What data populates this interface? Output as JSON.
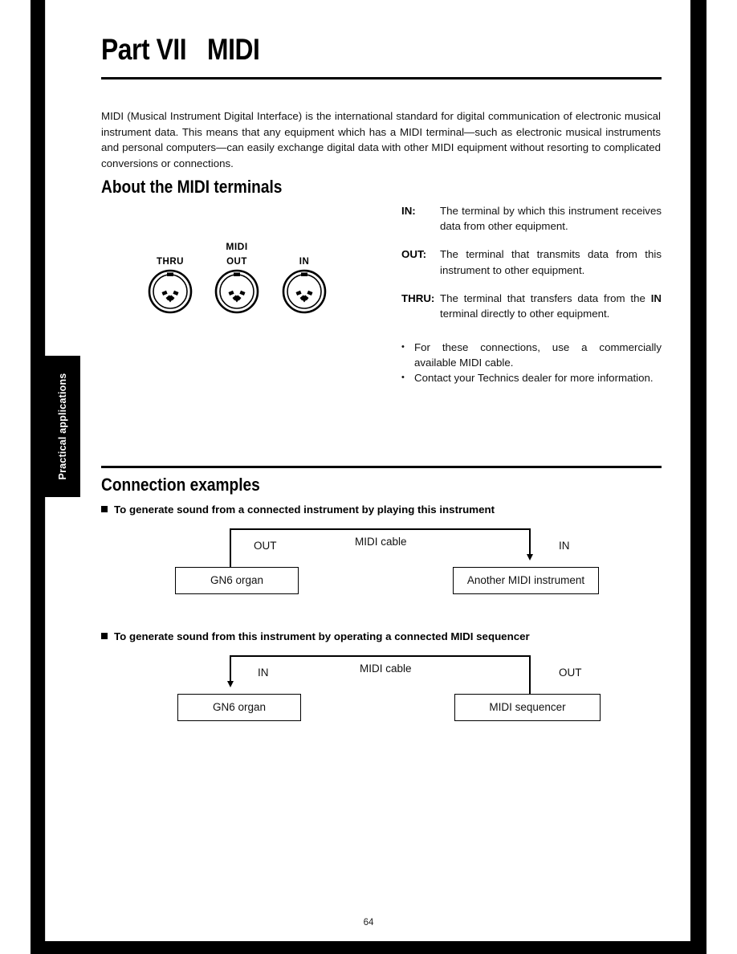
{
  "page": {
    "number": "64",
    "side_tab_label": "Practical applications"
  },
  "header": {
    "part_label": "Part VII",
    "part_title": "MIDI"
  },
  "intro": {
    "paragraph": "MIDI (Musical Instrument Digital Interface) is the international standard for digital communication of electronic musical instrument data. This means that any equipment which has a MIDI terminal—such as electronic musical instruments and personal computers—can easily exchange digital data with other MIDI equipment without resorting to complicated conversions or connections."
  },
  "terminals_section": {
    "heading": "About the MIDI terminals",
    "diagram": {
      "group_label": "MIDI",
      "jacks": [
        {
          "label": "THRU"
        },
        {
          "label": "OUT"
        },
        {
          "label": "IN"
        }
      ]
    },
    "definitions": [
      {
        "term": "IN:",
        "description": "The terminal by which this instrument receives data from other equipment."
      },
      {
        "term": "OUT:",
        "description": "The terminal that transmits data from this instrument to other equipment."
      },
      {
        "term": "THRU:",
        "description_pre": "The terminal that transfers data from the ",
        "description_bold": "IN",
        "description_post": " terminal directly to other equipment."
      }
    ],
    "notes": [
      "For these connections, use a commercially available MIDI cable.",
      "Contact your Technics dealer for more information."
    ],
    "note_bullet": "•"
  },
  "connections_section": {
    "heading": "Connection examples",
    "examples": [
      {
        "subheading": "To generate sound from a connected instrument by playing this instrument",
        "source_box": "GN6  organ",
        "source_port": "OUT",
        "cable_label": "MIDI cable",
        "target_box": "Another MIDI instrument",
        "target_port": "IN"
      },
      {
        "subheading": "To generate sound from this instrument by operating a connected MIDI sequencer",
        "source_box": "GN6  organ",
        "source_port": "IN",
        "cable_label": "MIDI cable",
        "target_box": "MIDI sequencer",
        "target_port": "OUT"
      }
    ]
  },
  "colors": {
    "ink": "#000000",
    "paper": "#ffffff"
  }
}
